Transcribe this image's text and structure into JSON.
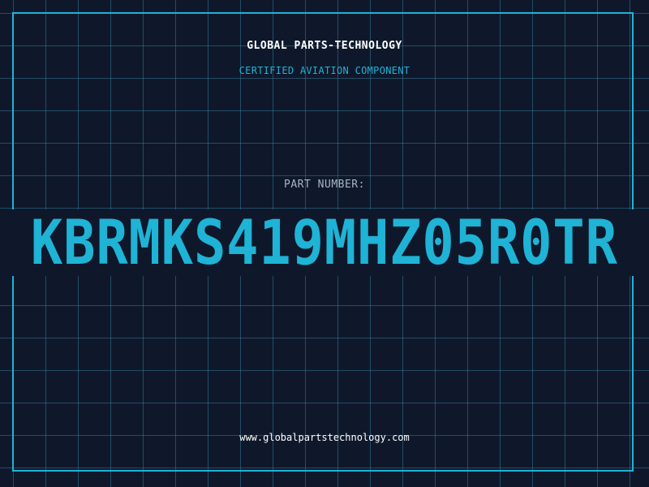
{
  "header": {
    "company_name": "GLOBAL PARTS-TECHNOLOGY",
    "tagline": "CERTIFIED AVIATION COMPONENT"
  },
  "part": {
    "label": "PART NUMBER:",
    "number": "KBRMKS419MHZ05R0TR"
  },
  "footer": {
    "website": "www.globalpartstechnology.com"
  },
  "colors": {
    "background": "#0f182b",
    "accent": "#1fb3d6",
    "grid": "#3c8caa",
    "label": "#a8b4c4",
    "text": "#ffffff"
  }
}
